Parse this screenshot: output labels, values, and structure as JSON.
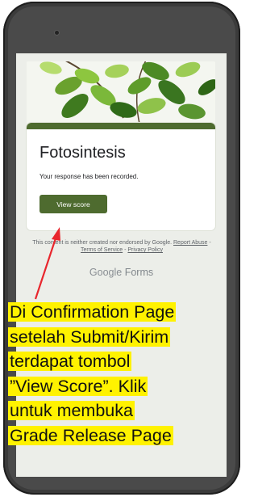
{
  "form": {
    "title": "Fotosintesis",
    "confirmation_message": "Your response has been recorded.",
    "view_score_label": "View score"
  },
  "footer": {
    "disclaimer": "This content is neither created nor endorsed by Google.",
    "report_abuse": "Report Abuse",
    "separator": "-",
    "terms": "Terms of Service",
    "privacy": "Privacy Policy",
    "brand_google": "Google",
    "brand_forms": "Forms"
  },
  "annotation": {
    "lines": [
      "Di Confirmation Page",
      "setelah Submit/Kirim",
      "terdapat tombol",
      "”View Score”. Klik",
      "untuk membuka",
      "Grade Release Page"
    ]
  },
  "colors": {
    "theme": "#4e6b2f",
    "highlight": "#fff200",
    "arrow": "#e8262d"
  }
}
